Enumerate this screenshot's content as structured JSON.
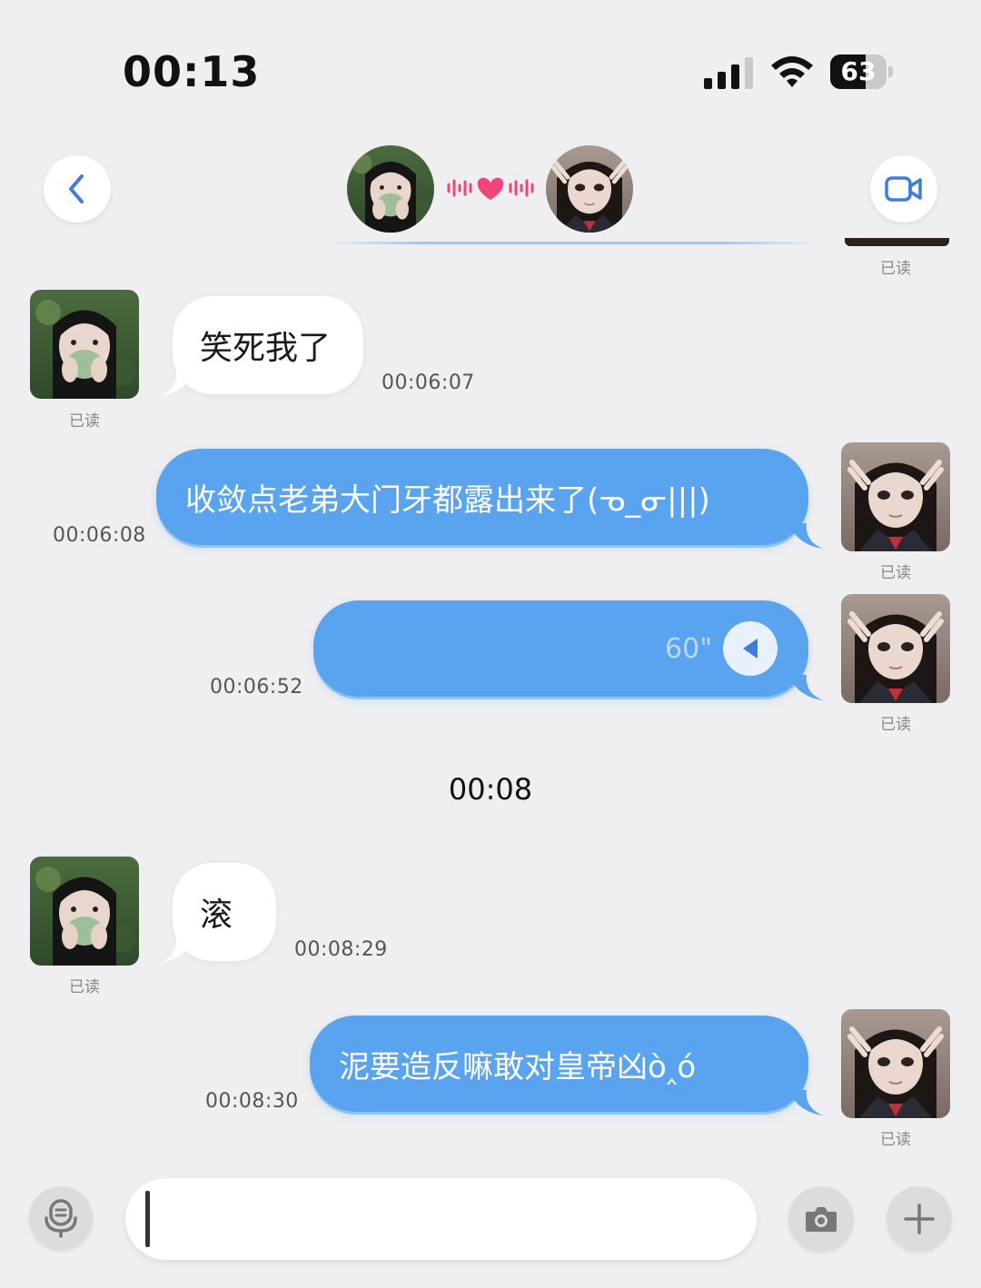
{
  "status_bar": {
    "time": "00:13",
    "battery": "63",
    "battery_level": 0.63
  },
  "header": {
    "back_icon": "chevron-left-icon",
    "video_icon": "video-camera-icon",
    "link_icon": "heart-soundwave-icon",
    "read_label": "已读"
  },
  "messages": [
    {
      "side": "in",
      "type": "text",
      "text": "笑死我了",
      "time": "00:06:07",
      "read": "已读"
    },
    {
      "side": "out",
      "type": "text",
      "text": "收敛点老弟大门牙都露出来了(ᓀ_ᓂ|||)",
      "time": "00:06:08",
      "read": "已读"
    },
    {
      "side": "out",
      "type": "voice",
      "text": "60\"",
      "time": "00:06:52",
      "read": "已读"
    },
    {
      "side": "in",
      "type": "text",
      "text": "滚",
      "time": "00:08:29",
      "read": "已读"
    },
    {
      "side": "out",
      "type": "text",
      "text": "泥要造反嘛敢对皇帝凶ò‸ó",
      "time": "00:08:30",
      "read": "已读"
    }
  ],
  "center_time": "00:08",
  "input_bar": {
    "mic_icon": "voice-input-icon",
    "camera_icon": "camera-icon",
    "plus_icon": "plus-icon",
    "value": "",
    "placeholder": ""
  },
  "colors": {
    "background": "#efeff1",
    "outgoing_bubble": "#5aa3ee",
    "incoming_bubble": "#ffffff",
    "accent": "#3d7be0",
    "heart": "#f0457a"
  }
}
